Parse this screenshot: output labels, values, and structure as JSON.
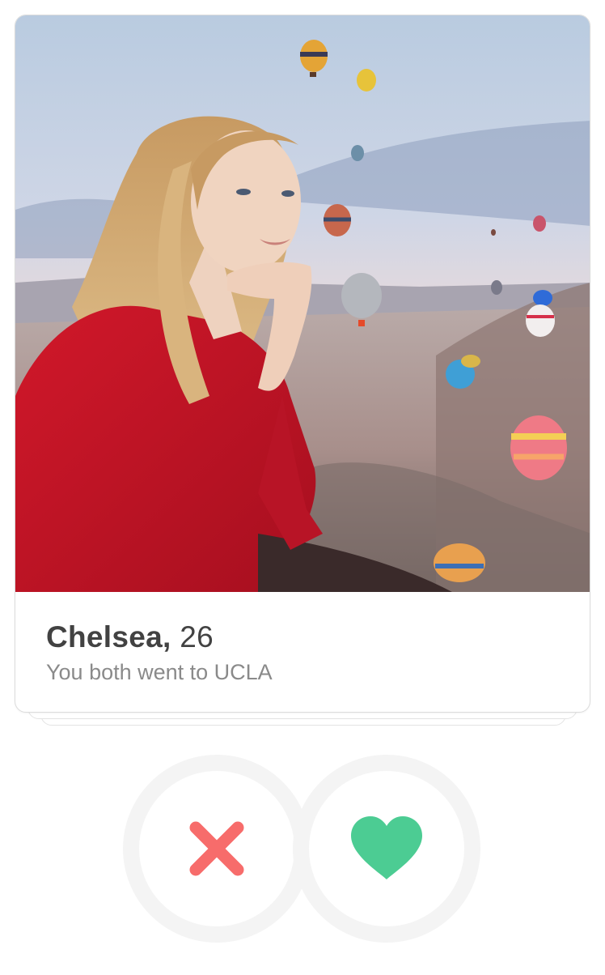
{
  "profile": {
    "name": "Chelsea,",
    "age": "26",
    "common": "You both went to UCLA",
    "photo_alt": "Woman in red shirt with hot air balloons"
  },
  "actions": {
    "nope": {
      "icon": "close-icon",
      "color": "#f76c6b"
    },
    "like": {
      "icon": "heart-icon",
      "color": "#4ccc93"
    }
  }
}
